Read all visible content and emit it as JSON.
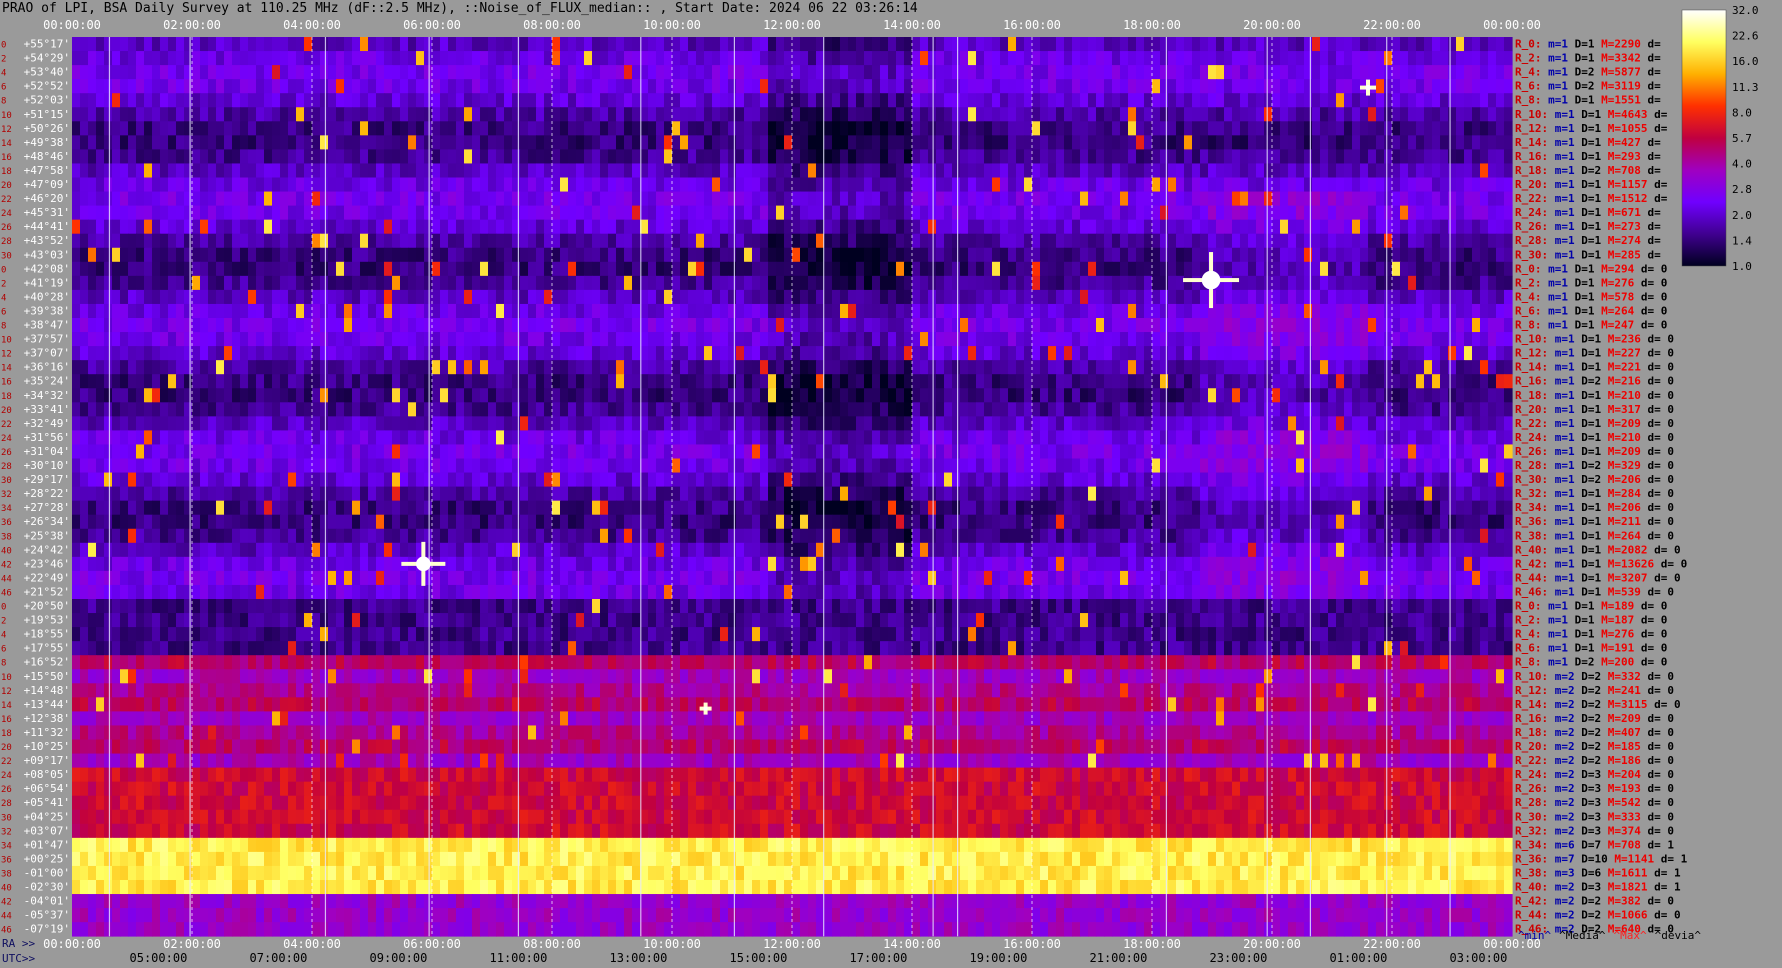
{
  "title": "PRAO of LPI, BSA Daily Survey at 110.25 MHz (dF::2.5 MHz), ::Noise_of_FLUX_median:: , Start Date: 2024 06 22 03:26:14",
  "footer": {
    "ra_label": "RA >>",
    "utc_label": "UTC>>",
    "legend": [
      {
        "text": "^min^",
        "color": "#0000aa"
      },
      {
        "text": "^Media^",
        "color": "#000000"
      },
      {
        "text": "^Max^",
        "color": "#ff2020"
      },
      {
        "text": "^devia^",
        "color": "#000000"
      }
    ]
  },
  "chart_data": {
    "type": "heatmap",
    "title": "PRAO of LPI, BSA Daily Survey at 110.25 MHz (dF::2.5 MHz), ::Noise_of_FLUX_median:: , Start Date: 2024 06 22 03:26:14",
    "x_top_ticks": [
      "00:00:00",
      "02:00:00",
      "04:00:00",
      "06:00:00",
      "08:00:00",
      "10:00:00",
      "12:00:00",
      "14:00:00",
      "16:00:00",
      "18:00:00",
      "20:00:00",
      "22:00:00",
      "00:00:00"
    ],
    "x_ra_ticks": [
      "00:00:00",
      "02:00:00",
      "04:00:00",
      "06:00:00",
      "08:00:00",
      "10:00:00",
      "12:00:00",
      "14:00:00",
      "16:00:00",
      "18:00:00",
      "20:00:00",
      "22:00:00",
      "00:00:00"
    ],
    "x_utc_ticks": [
      "05:00:00",
      "07:00:00",
      "09:00:00",
      "11:00:00",
      "13:00:00",
      "15:00:00",
      "17:00:00",
      "19:00:00",
      "21:00:00",
      "23:00:00",
      "01:00:00",
      "03:00:00"
    ],
    "y_decl_labels": [
      "+55°17'",
      "+54°29'",
      "+53°40'",
      "+52°52'",
      "+52°03'",
      "+51°15'",
      "+50°26'",
      "+49°38'",
      "+48°46'",
      "+47°58'",
      "+47°09'",
      "+46°20'",
      "+45°31'",
      "+44°41'",
      "+43°52'",
      "+43°03'",
      "+42°08'",
      "+41°19'",
      "+40°28'",
      "+39°38'",
      "+38°47'",
      "+37°57'",
      "+37°07'",
      "+36°16'",
      "+35°24'",
      "+34°32'",
      "+33°41'",
      "+32°49'",
      "+31°56'",
      "+31°04'",
      "+30°10'",
      "+29°17'",
      "+28°22'",
      "+27°28'",
      "+26°34'",
      "+25°38'",
      "+24°42'",
      "+23°46'",
      "+22°49'",
      "+21°52'",
      "+20°50'",
      "+19°53'",
      "+18°55'",
      "+17°55'",
      "+16°52'",
      "+15°50'",
      "+14°48'",
      "+13°44'",
      "+12°38'",
      "+11°32'",
      "+10°25'",
      "+09°17'",
      "+08°05'",
      "+06°54'",
      "+05°41'",
      "+04°25'",
      "+03°07'",
      "+01°47'",
      "+00°25'",
      "-01°00'",
      "-02°30'",
      "-04°01'",
      "-05°37'",
      "-07°19'"
    ],
    "y_index": [
      "0",
      "2",
      "4",
      "6",
      "8",
      "10",
      "12",
      "14",
      "16",
      "18",
      "20",
      "22",
      "24",
      "26",
      "28",
      "30",
      "0",
      "2",
      "4",
      "6",
      "8",
      "10",
      "12",
      "14",
      "16",
      "18",
      "20",
      "22",
      "24",
      "26",
      "28",
      "30",
      "32",
      "34",
      "36",
      "38",
      "40",
      "42",
      "44",
      "46",
      "0",
      "2",
      "4",
      "6",
      "8",
      "10",
      "12",
      "14",
      "16",
      "18",
      "20",
      "22",
      "24",
      "26",
      "28",
      "30",
      "32",
      "34",
      "36",
      "38",
      "40",
      "42",
      "44",
      "46"
    ],
    "colorbar": {
      "ticks": [
        "32.0",
        "22.6",
        "16.0",
        "11.3",
        "8.0",
        "5.7",
        "4.0",
        "2.8",
        "2.0",
        "1.4",
        "1.0"
      ],
      "scale": "log",
      "colors": [
        "#ffffff",
        "#ffff60",
        "#ffb000",
        "#ff3000",
        "#c00040",
        "#a000c0",
        "#7000ff",
        "#400090",
        "#000020"
      ]
    },
    "stats": [
      {
        "r": "R_0:",
        "m": "1",
        "d": "1",
        "M": "2290",
        "dev": ""
      },
      {
        "r": "R_2:",
        "m": "1",
        "d": "1",
        "M": "3342",
        "dev": ""
      },
      {
        "r": "R_4:",
        "m": "1",
        "d": "2",
        "M": "5877",
        "dev": ""
      },
      {
        "r": "R_6:",
        "m": "1",
        "d": "2",
        "M": "3119",
        "dev": ""
      },
      {
        "r": "R_8:",
        "m": "1",
        "d": "1",
        "M": "1551",
        "dev": ""
      },
      {
        "r": "R_10:",
        "m": "1",
        "d": "1",
        "M": "4643",
        "dev": ""
      },
      {
        "r": "R_12:",
        "m": "1",
        "d": "1",
        "M": "1055",
        "dev": ""
      },
      {
        "r": "R_14:",
        "m": "1",
        "d": "1",
        "M": "427",
        "dev": ""
      },
      {
        "r": "R_16:",
        "m": "1",
        "d": "1",
        "M": "293",
        "dev": ""
      },
      {
        "r": "R_18:",
        "m": "1",
        "d": "2",
        "M": "708",
        "dev": ""
      },
      {
        "r": "R_20:",
        "m": "1",
        "d": "1",
        "M": "1157",
        "dev": ""
      },
      {
        "r": "R_22:",
        "m": "1",
        "d": "1",
        "M": "1512",
        "dev": ""
      },
      {
        "r": "R_24:",
        "m": "1",
        "d": "1",
        "M": "671",
        "dev": ""
      },
      {
        "r": "R_26:",
        "m": "1",
        "d": "1",
        "M": "273",
        "dev": ""
      },
      {
        "r": "R_28:",
        "m": "1",
        "d": "1",
        "M": "274",
        "dev": ""
      },
      {
        "r": "R_30:",
        "m": "1",
        "d": "1",
        "M": "285",
        "dev": ""
      },
      {
        "r": "R_0:",
        "m": "1",
        "d": "1",
        "M": "294",
        "dev": "0"
      },
      {
        "r": "R_2:",
        "m": "1",
        "d": "1",
        "M": "276",
        "dev": "0"
      },
      {
        "r": "R_4:",
        "m": "1",
        "d": "1",
        "M": "578",
        "dev": "0"
      },
      {
        "r": "R_6:",
        "m": "1",
        "d": "1",
        "M": "264",
        "dev": "0"
      },
      {
        "r": "R_8:",
        "m": "1",
        "d": "1",
        "M": "247",
        "dev": "0"
      },
      {
        "r": "R_10:",
        "m": "1",
        "d": "1",
        "M": "236",
        "dev": "0"
      },
      {
        "r": "R_12:",
        "m": "1",
        "d": "1",
        "M": "227",
        "dev": "0"
      },
      {
        "r": "R_14:",
        "m": "1",
        "d": "1",
        "M": "221",
        "dev": "0"
      },
      {
        "r": "R_16:",
        "m": "1",
        "d": "2",
        "M": "216",
        "dev": "0"
      },
      {
        "r": "R_18:",
        "m": "1",
        "d": "1",
        "M": "210",
        "dev": "0"
      },
      {
        "r": "R_20:",
        "m": "1",
        "d": "1",
        "M": "317",
        "dev": "0"
      },
      {
        "r": "R_22:",
        "m": "1",
        "d": "1",
        "M": "209",
        "dev": "0"
      },
      {
        "r": "R_24:",
        "m": "1",
        "d": "1",
        "M": "210",
        "dev": "0"
      },
      {
        "r": "R_26:",
        "m": "1",
        "d": "1",
        "M": "209",
        "dev": "0"
      },
      {
        "r": "R_28:",
        "m": "1",
        "d": "2",
        "M": "329",
        "dev": "0"
      },
      {
        "r": "R_30:",
        "m": "1",
        "d": "2",
        "M": "206",
        "dev": "0"
      },
      {
        "r": "R_32:",
        "m": "1",
        "d": "1",
        "M": "284",
        "dev": "0"
      },
      {
        "r": "R_34:",
        "m": "1",
        "d": "1",
        "M": "206",
        "dev": "0"
      },
      {
        "r": "R_36:",
        "m": "1",
        "d": "1",
        "M": "211",
        "dev": "0"
      },
      {
        "r": "R_38:",
        "m": "1",
        "d": "1",
        "M": "264",
        "dev": "0"
      },
      {
        "r": "R_40:",
        "m": "1",
        "d": "1",
        "M": "2082",
        "dev": "0"
      },
      {
        "r": "R_42:",
        "m": "1",
        "d": "1",
        "M": "13626",
        "dev": "0"
      },
      {
        "r": "R_44:",
        "m": "1",
        "d": "1",
        "M": "3207",
        "dev": "0"
      },
      {
        "r": "R_46:",
        "m": "1",
        "d": "1",
        "M": "539",
        "dev": "0"
      },
      {
        "r": "R_0:",
        "m": "1",
        "d": "1",
        "M": "189",
        "dev": "0"
      },
      {
        "r": "R_2:",
        "m": "1",
        "d": "1",
        "M": "187",
        "dev": "0"
      },
      {
        "r": "R_4:",
        "m": "1",
        "d": "1",
        "M": "276",
        "dev": "0"
      },
      {
        "r": "R_6:",
        "m": "1",
        "d": "1",
        "M": "191",
        "dev": "0"
      },
      {
        "r": "R_8:",
        "m": "1",
        "d": "2",
        "M": "200",
        "dev": "0"
      },
      {
        "r": "R_10:",
        "m": "2",
        "d": "2",
        "M": "332",
        "dev": "0"
      },
      {
        "r": "R_12:",
        "m": "2",
        "d": "2",
        "M": "241",
        "dev": "0"
      },
      {
        "r": "R_14:",
        "m": "2",
        "d": "2",
        "M": "3115",
        "dev": "0"
      },
      {
        "r": "R_16:",
        "m": "2",
        "d": "2",
        "M": "209",
        "dev": "0"
      },
      {
        "r": "R_18:",
        "m": "2",
        "d": "2",
        "M": "407",
        "dev": "0"
      },
      {
        "r": "R_20:",
        "m": "2",
        "d": "2",
        "M": "185",
        "dev": "0"
      },
      {
        "r": "R_22:",
        "m": "2",
        "d": "2",
        "M": "186",
        "dev": "0"
      },
      {
        "r": "R_24:",
        "m": "2",
        "d": "3",
        "M": "204",
        "dev": "0"
      },
      {
        "r": "R_26:",
        "m": "2",
        "d": "3",
        "M": "193",
        "dev": "0"
      },
      {
        "r": "R_28:",
        "m": "2",
        "d": "3",
        "M": "542",
        "dev": "0"
      },
      {
        "r": "R_30:",
        "m": "2",
        "d": "3",
        "M": "333",
        "dev": "0"
      },
      {
        "r": "R_32:",
        "m": "2",
        "d": "3",
        "M": "374",
        "dev": "0"
      },
      {
        "r": "R_34:",
        "m": "6",
        "d": "7",
        "M": "708",
        "dev": "1"
      },
      {
        "r": "R_36:",
        "m": "7",
        "d": "10",
        "M": "1141",
        "dev": "1"
      },
      {
        "r": "R_38:",
        "m": "3",
        "d": "6",
        "M": "1611",
        "dev": "1"
      },
      {
        "r": "R_40:",
        "m": "2",
        "d": "3",
        "M": "1821",
        "dev": "1"
      },
      {
        "r": "R_42:",
        "m": "2",
        "d": "2",
        "M": "382",
        "dev": "0"
      },
      {
        "r": "R_44:",
        "m": "2",
        "d": "2",
        "M": "1066",
        "dev": "0"
      },
      {
        "r": "R_46:",
        "m": "2",
        "d": "2",
        "M": "640",
        "dev": "0"
      }
    ]
  }
}
